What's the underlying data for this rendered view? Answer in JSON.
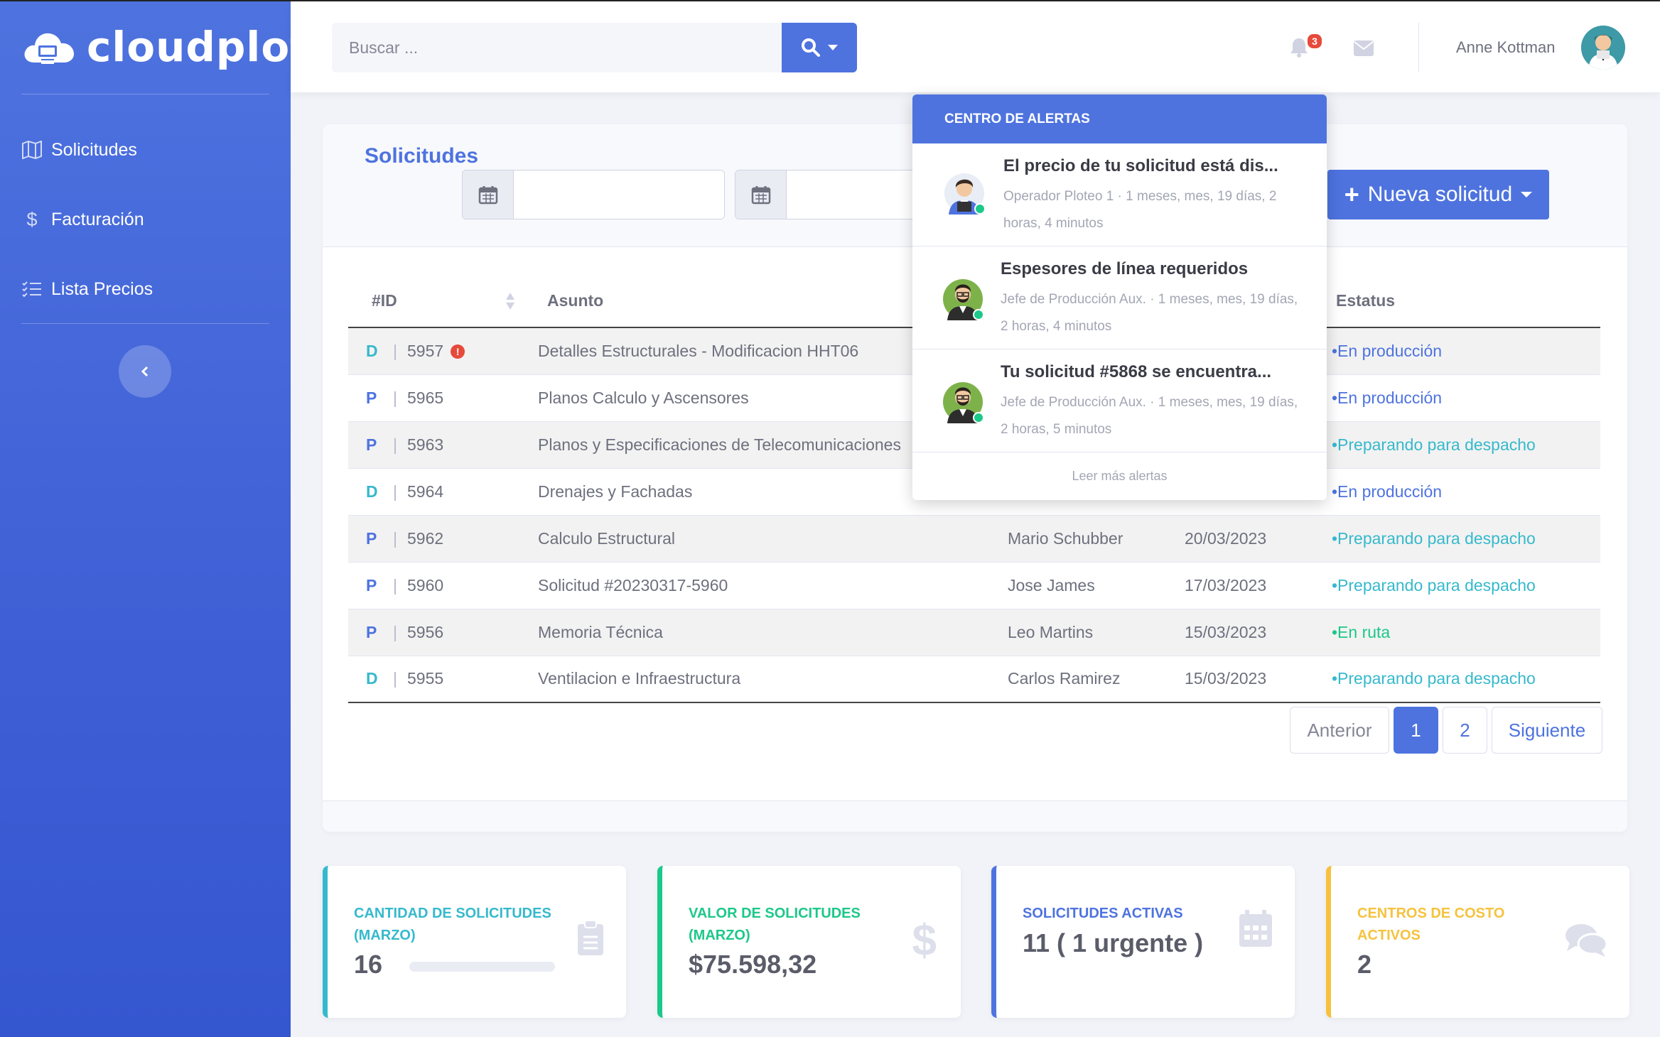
{
  "brand": {
    "name": "cloudplot"
  },
  "sidebar": {
    "items": [
      {
        "label": "Solicitudes",
        "icon": "map-icon"
      },
      {
        "label": "Facturación",
        "icon": "dollar-icon"
      },
      {
        "label": "Lista Precios",
        "icon": "list-check-icon"
      }
    ],
    "toggle_icon": "chevron-left-icon"
  },
  "topbar": {
    "search_placeholder": "Buscar ...",
    "notification_count": "3",
    "user_name": "Anne Kottman"
  },
  "main": {
    "title": "Solicitudes",
    "new_button_label": "Nueva solicitud",
    "table": {
      "columns": [
        "#ID",
        "Asunto",
        "Estatus"
      ],
      "rows": [
        {
          "type": "D",
          "id": "5957",
          "urgent": true,
          "subject": "Detalles Estructurales - Modificacion HHT06",
          "requester": "",
          "date": "",
          "status": "•En producción",
          "status_kind": "prod"
        },
        {
          "type": "P",
          "id": "5965",
          "urgent": false,
          "subject": "Planos Calculo y Ascensores",
          "requester": "",
          "date": "",
          "status": "•En producción",
          "status_kind": "prod"
        },
        {
          "type": "P",
          "id": "5963",
          "urgent": false,
          "subject": "Planos y Especificaciones de Telecomunicaciones",
          "requester": "",
          "date": "",
          "status": "•Preparando para despacho",
          "status_kind": "desp"
        },
        {
          "type": "D",
          "id": "5964",
          "urgent": false,
          "subject": "Drenajes y Fachadas",
          "requester": "",
          "date": "",
          "status": "•En producción",
          "status_kind": "prod"
        },
        {
          "type": "P",
          "id": "5962",
          "urgent": false,
          "subject": "Calculo Estructural",
          "requester": "Mario Schubber",
          "date": "20/03/2023",
          "status": "•Preparando para despacho",
          "status_kind": "desp"
        },
        {
          "type": "P",
          "id": "5960",
          "urgent": false,
          "subject": "Solicitud #20230317-5960",
          "requester": "Jose James",
          "date": "17/03/2023",
          "status": "•Preparando para despacho",
          "status_kind": "desp"
        },
        {
          "type": "P",
          "id": "5956",
          "urgent": false,
          "subject": "Memoria Técnica",
          "requester": "Leo Martins",
          "date": "15/03/2023",
          "status": "•En ruta",
          "status_kind": "ruta"
        },
        {
          "type": "D",
          "id": "5955",
          "urgent": false,
          "subject": "Ventilacion e Infraestructura",
          "requester": "Carlos Ramirez",
          "date": "15/03/2023",
          "status": "•Preparando para despacho",
          "status_kind": "desp"
        }
      ]
    },
    "pagination": {
      "prev": "Anterior",
      "pages": [
        "1",
        "2"
      ],
      "active": "1",
      "next": "Siguiente"
    }
  },
  "stats": [
    {
      "label": "CANTIDAD DE SOLICITUDES (MARZO)",
      "value": "16",
      "color": "#36b9cc",
      "icon": "clipboard-icon",
      "progress": 0.0
    },
    {
      "label": "VALOR DE SOLICITUDES (MARZO)",
      "value": "$75.598,32",
      "color": "#1cc88a",
      "icon": "dollar-icon"
    },
    {
      "label": "SOLICITUDES ACTIVAS",
      "value": "11 ( 1 urgente )",
      "color": "#4e73df",
      "icon": "calendar-icon"
    },
    {
      "label": "CENTROS DE COSTO ACTIVOS",
      "value": "2",
      "color": "#f6c23e",
      "icon": "comments-icon"
    }
  ],
  "alerts": {
    "header": "CENTRO DE ALERTAS",
    "items": [
      {
        "title": "El precio de tu solicitud está dis...",
        "subtitle": "Operador Ploteo 1 · 1 meses, mes, 19 días, 2 horas, 4 minutos"
      },
      {
        "title": "Espesores de línea requeridos",
        "subtitle": "Jefe de Producción Aux. · 1 meses, mes, 19 días, 2 horas, 4 minutos"
      },
      {
        "title": "Tu solicitud #5868 se encuentra...",
        "subtitle": "Jefe de Producción Aux. · 1 meses, mes, 19 días, 2 horas, 5 minutos"
      }
    ],
    "footer": "Leer más alertas"
  }
}
